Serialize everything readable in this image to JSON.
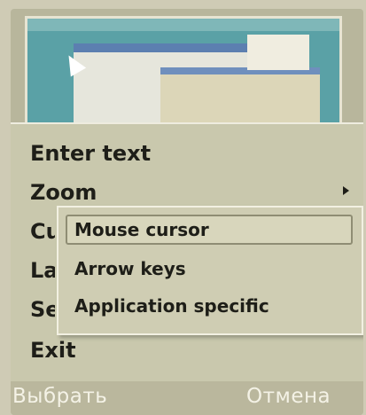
{
  "menu": {
    "items": [
      {
        "label": "Enter text"
      },
      {
        "label": "Zoom"
      },
      {
        "label": "Cursor"
      },
      {
        "label": "Language"
      },
      {
        "label": "Settings"
      },
      {
        "label": "Exit"
      }
    ],
    "submenu": {
      "items": [
        {
          "label": "Mouse cursor"
        },
        {
          "label": "Arrow keys"
        },
        {
          "label": "Application specific"
        }
      ]
    }
  },
  "softkeys": {
    "left": "Выбрать",
    "right": "Отмена"
  }
}
